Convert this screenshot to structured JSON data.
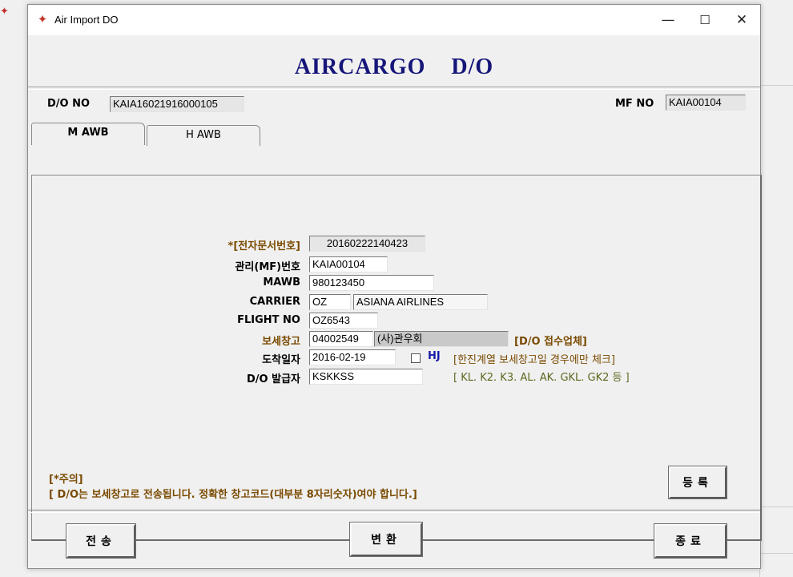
{
  "window": {
    "title": "Air Import DO",
    "minimize_glyph": "—",
    "maximize_glyph": "☐",
    "close_glyph": "✕"
  },
  "icons": {
    "app": "compass-rose-icon"
  },
  "header": {
    "title": "AIRCARGO    D/O",
    "do_no_label": "D/O NO",
    "do_no_value": "KAIA16021916000105",
    "mf_no_label": "MF NO",
    "mf_no_value": "KAIA00104"
  },
  "tabs": [
    {
      "label": "M AWB",
      "active": true
    },
    {
      "label": "H AWB",
      "active": false
    }
  ],
  "form": {
    "edoc_label": "*[전자문서번호]",
    "edoc_value": "20160222140423",
    "mf_label": "관리(MF)번호",
    "mf_value": "KAIA00104",
    "mawb_label": "MAWB",
    "mawb_value": "980123450",
    "carrier_label": "CARRIER",
    "carrier_code": "OZ",
    "carrier_name": "ASIANA AIRLINES",
    "flight_label": "FLIGHT NO",
    "flight_value": "OZ6543",
    "warehouse_label": "보세창고",
    "warehouse_code": "04002549",
    "warehouse_name": "(사)관우회",
    "warehouse_note": "[D/O 접수업체]",
    "arrival_label": "도착일자",
    "arrival_value": "2016-02-19",
    "hj_label": "HJ",
    "hj_checked": false,
    "hj_note": "[한진계열 보세창고일 경우에만 체크]",
    "hj_note2": "[ KL. K2. K3. AL. AK. GKL. GK2 등 ]",
    "issuer_label": "D/O 발급자",
    "issuer_value": "KSKKSS"
  },
  "notice": {
    "title": "[*주의]",
    "text": "[ D/O는 보세창고로 전송됩니다. 정확한 창고코드(대부분 8자리숫자)여야 합니다.]"
  },
  "buttons": {
    "register": "등록",
    "send": "전송",
    "convert": "변환",
    "exit": "종료"
  },
  "colors": {
    "header_title": "#16167a",
    "accent_label": "#7a4a00",
    "note_brown": "#7a4a00",
    "note_olive": "#5a6a20",
    "hj_blue": "#1a1aa8"
  }
}
